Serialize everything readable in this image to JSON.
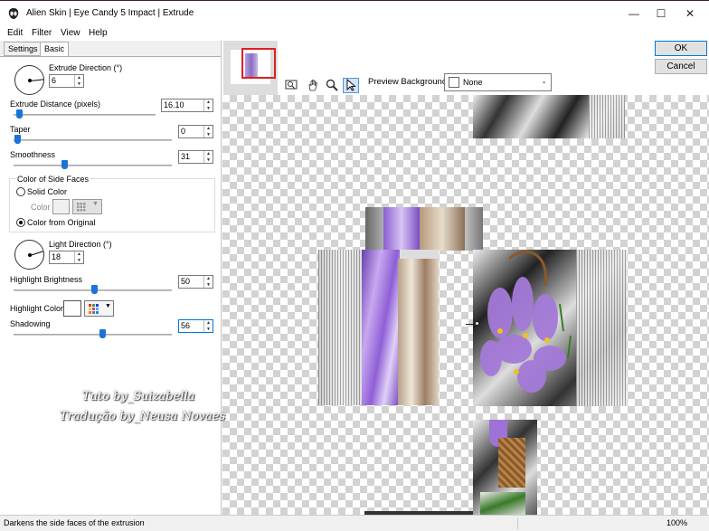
{
  "window": {
    "title": "Alien Skin | Eye Candy 5 Impact | Extrude",
    "controls": {
      "minimize": "—",
      "maximize": "☐",
      "close": "✕"
    }
  },
  "menu": [
    "Edit",
    "Filter",
    "View",
    "Help"
  ],
  "tabs": [
    "Settings",
    "Basic"
  ],
  "basic": {
    "extrude_direction": {
      "label": "Extrude Direction (°)",
      "value": "6"
    },
    "extrude_distance": {
      "label": "Extrude Distance (pixels)",
      "value": "16.10",
      "level": 0.08
    },
    "taper": {
      "label": "Taper",
      "value": "0",
      "level": 0.03
    },
    "smoothness": {
      "label": "Smoothness",
      "value": "31",
      "level": 0.31
    },
    "color_side": {
      "title": "Color of Side Faces",
      "solid_label": "Solid Color",
      "color_label": "Color",
      "original_label": "Color from Original"
    },
    "light_direction": {
      "label": "Light Direction (°)",
      "value": "18"
    },
    "highlight_brightness": {
      "label": "Highlight Brightness",
      "value": "50",
      "level": 0.5
    },
    "highlight_color_label": "Highlight Color",
    "shadowing": {
      "label": "Shadowing",
      "value": "56",
      "level": 0.56
    }
  },
  "watermark": {
    "line1": "Tuto by_Suizabella",
    "line2": "Tradução by_Neusa Novaes"
  },
  "preview_bg": {
    "label": "Preview Background:",
    "value": "None"
  },
  "buttons": {
    "ok": "OK",
    "cancel": "Cancel"
  },
  "status": {
    "text": "Darkens the side faces of the extrusion",
    "zoom": "100%"
  },
  "colors": {
    "accent": "#1a73d8",
    "selection": "#cfe3fb",
    "flower": "#a47ad8"
  },
  "icons": [
    "alien-skin-icon",
    "navigator-icon",
    "hand-icon",
    "zoom-icon",
    "pointer-icon",
    "spin-up-icon",
    "spin-down-icon",
    "color-grid-icon",
    "dropdown-arrow-icon"
  ]
}
